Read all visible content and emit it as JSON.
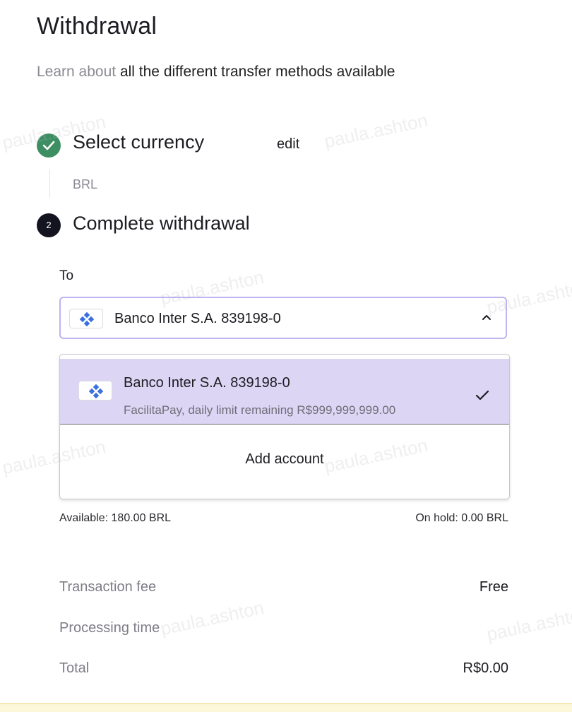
{
  "page": {
    "title": "Withdrawal",
    "intro_link": "Learn about",
    "intro_text": "all the different transfer methods available"
  },
  "steps": {
    "step1": {
      "label": "Select currency",
      "edit_label": "edit",
      "value": "BRL",
      "status": "completed"
    },
    "step2": {
      "number": "2",
      "label": "Complete withdrawal"
    }
  },
  "withdraw_form": {
    "to_label": "To",
    "selected_account": "Banco Inter S.A. 839198-0",
    "dropdown": {
      "options": [
        {
          "title": "Banco Inter S.A. 839198-0",
          "subtitle": "FacilitaPay, daily limit remaining R$999,999,999.00",
          "selected": true
        }
      ],
      "add_account_label": "Add account"
    },
    "available": "Available:  180.00 BRL",
    "on_hold": "On hold:  0.00 BRL"
  },
  "summary": {
    "transaction_fee_label": "Transaction fee",
    "transaction_fee_value": "Free",
    "processing_time_label": "Processing time",
    "processing_time_value": "",
    "total_label": "Total",
    "total_value": "R$0.00"
  },
  "watermark": "paula.ashton",
  "colors": {
    "success_green": "#3d8f63",
    "step_dark": "#141421",
    "selected_bg": "#dcd5f4",
    "focus_border": "#bdb4f0",
    "bank_logo_blue": "#3b6fe0",
    "muted_text": "#8a8a93"
  },
  "icons": {
    "step1": "check-circle-icon",
    "bank": "bank-inter-logo-icon",
    "chevron": "chevron-up-icon",
    "selected": "checkmark-icon"
  }
}
